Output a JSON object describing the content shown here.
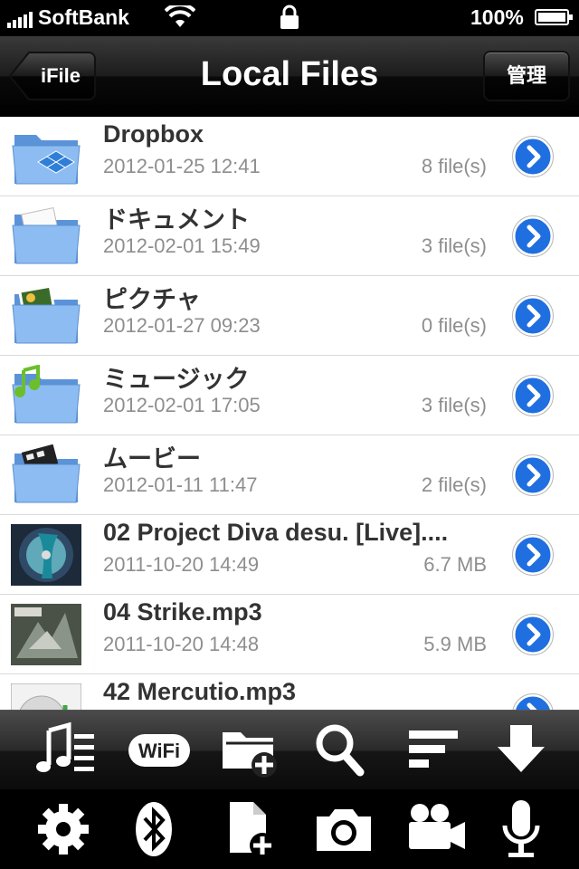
{
  "status_bar": {
    "carrier": "SoftBank",
    "battery": "100%"
  },
  "nav": {
    "back_label": "iFile",
    "title": "Local Files",
    "manage_label": "管理"
  },
  "files": [
    {
      "name": "Dropbox",
      "date": "2012-01-25 12:41",
      "meta": "8 file(s)",
      "icon": "dropbox-folder-icon"
    },
    {
      "name": "ドキュメント",
      "date": "2012-02-01 15:49",
      "meta": "3 file(s)",
      "icon": "documents-folder-icon"
    },
    {
      "name": "ピクチャ",
      "date": "2012-01-27 09:23",
      "meta": "0 file(s)",
      "icon": "pictures-folder-icon"
    },
    {
      "name": "ミュージック",
      "date": "2012-02-01 17:05",
      "meta": "3 file(s)",
      "icon": "music-folder-icon"
    },
    {
      "name": "ムービー",
      "date": "2012-01-11 11:47",
      "meta": "2 file(s)",
      "icon": "movies-folder-icon"
    },
    {
      "name": "02 Project Diva desu. [Live]....",
      "date": "2011-10-20 14:49",
      "meta": "6.7 MB",
      "icon": "album-art-thumbnail"
    },
    {
      "name": "04 Strike.mp3",
      "date": "2011-10-20 14:48",
      "meta": "5.9 MB",
      "icon": "album-art-thumbnail"
    },
    {
      "name": "42 Mercutio.mp3",
      "date": "",
      "meta": "",
      "icon": "music-file-icon"
    }
  ],
  "toolbar_top": [
    "playlist-icon",
    "wifi-icon",
    "new-folder-icon",
    "search-icon",
    "sort-icon",
    "download-icon"
  ],
  "toolbar_bottom": [
    "settings-gear-icon",
    "bluetooth-icon",
    "new-file-icon",
    "camera-icon",
    "video-camera-icon",
    "microphone-icon"
  ],
  "colors": {
    "disclosure_blue": "#1f6fe0",
    "folder_blue": "#7fb2ee",
    "text_dark": "#333333",
    "text_gray": "#8e8e8e"
  }
}
